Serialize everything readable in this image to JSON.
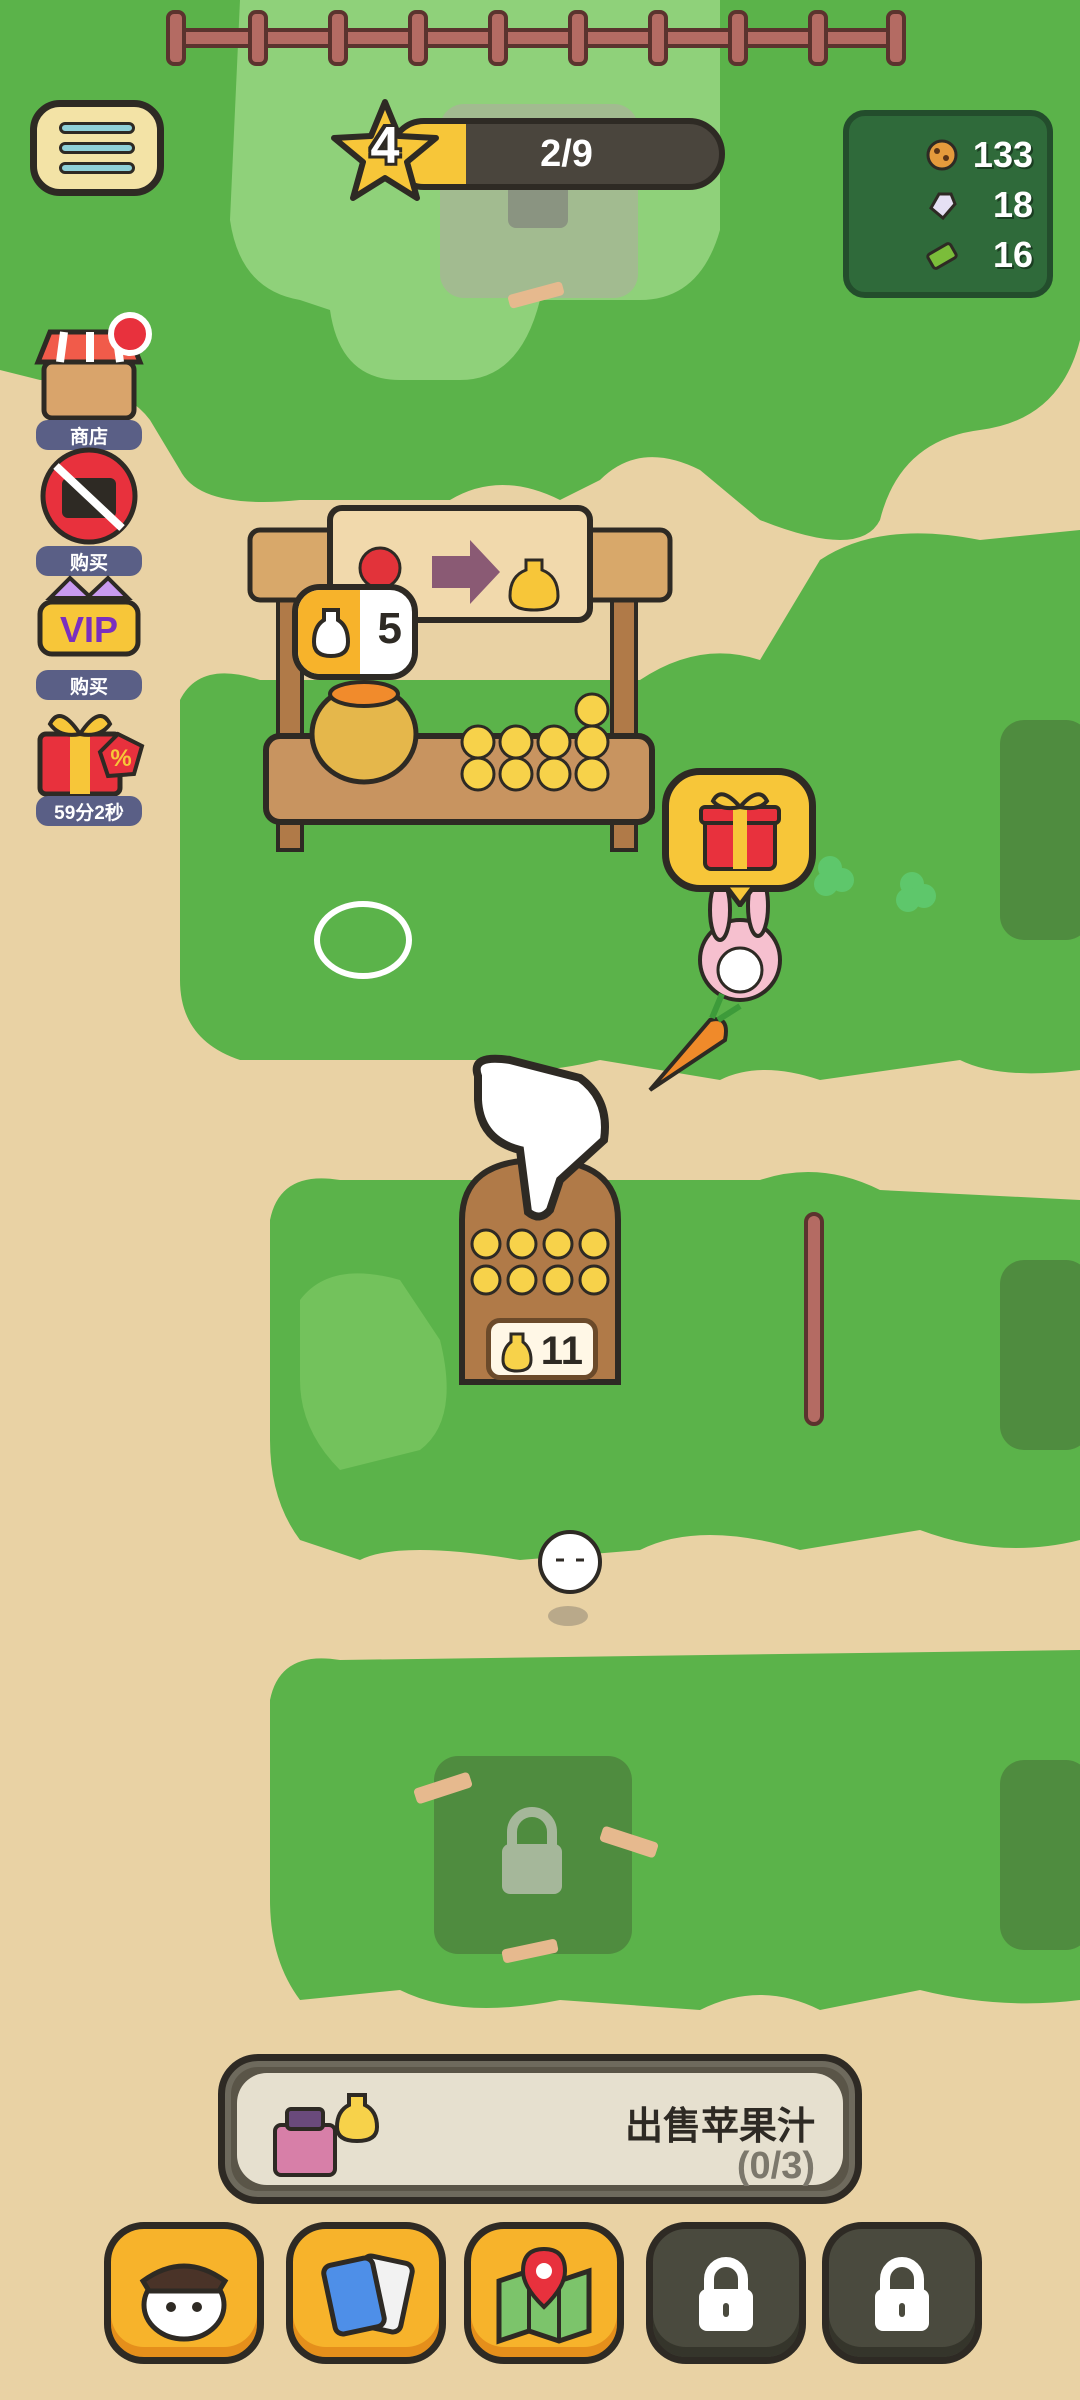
{
  "hud": {
    "menu_icon": "hamburger-menu-icon",
    "level": {
      "number": "4",
      "progress_text": "2/9",
      "progress_fraction": 0.22
    },
    "resources": [
      {
        "icon": "cookie-icon",
        "value": "133"
      },
      {
        "icon": "gem-icon",
        "value": "18"
      },
      {
        "icon": "cash-icon",
        "value": "16"
      }
    ]
  },
  "side_menu": [
    {
      "id": "shop",
      "icon": "shop-stall-icon",
      "label": "商店",
      "has_notification": true
    },
    {
      "id": "no-ads",
      "icon": "no-ads-icon",
      "label": "购买"
    },
    {
      "id": "vip",
      "icon": "vip-icon",
      "label": "购买"
    },
    {
      "id": "gift-sale",
      "icon": "gift-discount-icon",
      "label": "59分2秒"
    }
  ],
  "stall": {
    "sign": {
      "from_icon": "apple-icon",
      "to_icon": "juice-bottle-icon"
    },
    "queue_count": "5",
    "stock_count": "11"
  },
  "gift_bubble_icon": "gift-box-icon",
  "quest": {
    "title": "出售苹果汁",
    "progress": "(0/3)",
    "icon": "cash-register-icon"
  },
  "dock": [
    {
      "id": "character",
      "icon": "character-avatar-icon",
      "locked": false
    },
    {
      "id": "cards",
      "icon": "cards-icon",
      "locked": false
    },
    {
      "id": "map",
      "icon": "map-icon",
      "locked": false
    },
    {
      "id": "locked-1",
      "icon": "lock-icon",
      "locked": true
    },
    {
      "id": "locked-2",
      "icon": "lock-icon",
      "locked": true
    }
  ],
  "colors": {
    "grass": "#5bb34a",
    "grass_light": "#73c25c",
    "path": "#e9d2a4",
    "accent": "#f7b32b",
    "outline": "#2e2a24"
  }
}
